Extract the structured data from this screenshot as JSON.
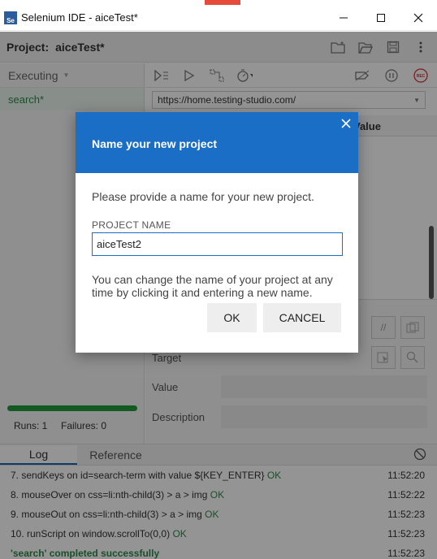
{
  "window": {
    "logo_text": "Se",
    "title": "Selenium IDE - aiceTest*",
    "minimize_label": "—",
    "maximize_label": "☐",
    "close_label": "✕"
  },
  "project": {
    "label": "Project:",
    "name": "aiceTest*"
  },
  "left": {
    "mode_label": "Executing",
    "suite_item": "search*",
    "runs": "Runs: 1",
    "failures": "Failures: 0",
    "progress_fraction": 1.0
  },
  "editor": {
    "url": "https://home.testing-studio.com/",
    "value_header": "Value",
    "fields": {
      "target": "Target",
      "value": "Value",
      "description": "Description"
    }
  },
  "bottom": {
    "tabs": [
      "Log",
      "Reference"
    ],
    "active_tab": "Log",
    "log": [
      {
        "text": "7.  sendKeys on id=search-term with value ${KEY_ENTER} ",
        "status": "OK",
        "time": "11:52:20"
      },
      {
        "text": "8.  mouseOver on css=li:nth-child(3) > a > img ",
        "status": "OK",
        "time": "11:52:22"
      },
      {
        "text": "9.  mouseOut on css=li:nth-child(3) > a > img ",
        "status": "OK",
        "time": "11:52:23"
      },
      {
        "text": "10. runScript on window.scrollTo(0,0) ",
        "status": "OK",
        "time": "11:52:23"
      }
    ],
    "completed": {
      "text": "'search' completed successfully",
      "time": "11:52:23"
    }
  },
  "dialog": {
    "title": "Name your new project",
    "close_label": "✕",
    "message": "Please provide a name for your new project.",
    "field_label": "PROJECT NAME",
    "field_value": "aiceTest2",
    "hint": "You can change the name of your project at any time by clicking it and entering a new name.",
    "ok_label": "OK",
    "cancel_label": "CANCEL"
  },
  "colors": {
    "dialog_header": "#1a6ec6",
    "success_green": "#2d8a4a",
    "progress_green": "#1f9a3c",
    "record_red": "#d8302f"
  }
}
